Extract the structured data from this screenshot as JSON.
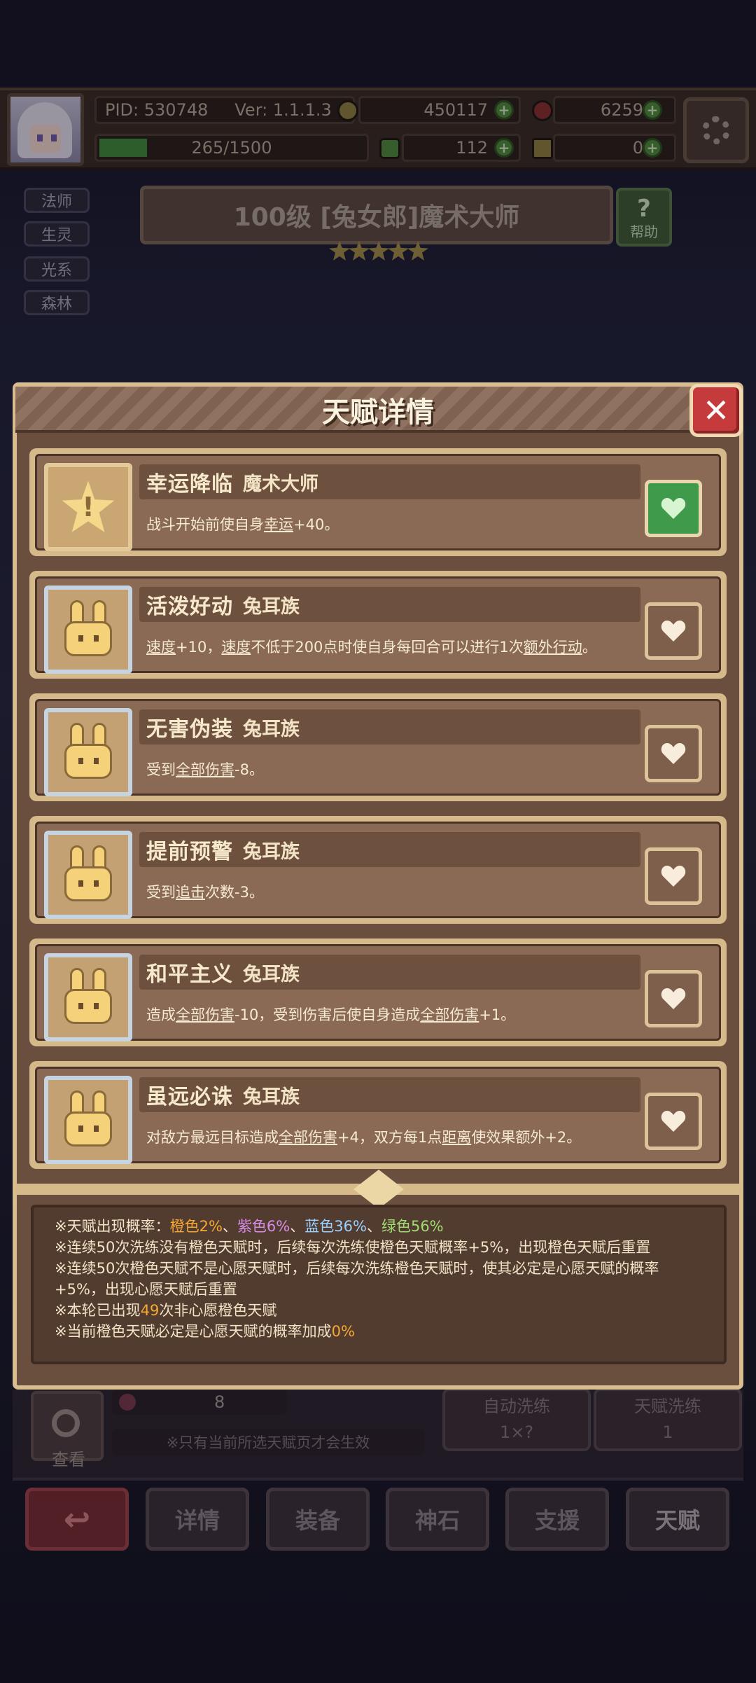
{
  "topbar": {
    "pid": "PID: 530748",
    "ver": "Ver: 1.1.1.3",
    "gold": "450117",
    "gem": "6259",
    "exp": "265/1500",
    "clover": "112",
    "hammer": "0"
  },
  "tags": [
    "法师",
    "生灵",
    "光系",
    "森林"
  ],
  "hero": {
    "title": "100级 [兔女郎]魔术大师",
    "help_label": "帮助",
    "help_symbol": "?"
  },
  "modal": {
    "title": "天赋详情",
    "close_symbol": "✕"
  },
  "talents": [
    {
      "name": "幸运降临",
      "source": "魔术大师",
      "icon": "star-icon",
      "wish": true,
      "desc": [
        {
          "t": "战斗开始前使自身"
        },
        {
          "t": "幸运",
          "u": true
        },
        {
          "t": "+40。"
        }
      ]
    },
    {
      "name": "活泼好动",
      "source": "兔耳族",
      "icon": "bunny-icon",
      "wish": false,
      "desc": [
        {
          "t": "速度",
          "u": true
        },
        {
          "t": "+10，"
        },
        {
          "t": "速度",
          "u": true
        },
        {
          "t": "不低于200点时使自身每回合可以进行1次"
        },
        {
          "t": "额外行动",
          "u": true
        },
        {
          "t": "。"
        }
      ]
    },
    {
      "name": "无害伪装",
      "source": "兔耳族",
      "icon": "bunny-icon",
      "wish": false,
      "desc": [
        {
          "t": "受到"
        },
        {
          "t": "全部伤害",
          "u": true
        },
        {
          "t": "-8。"
        }
      ]
    },
    {
      "name": "提前预警",
      "source": "兔耳族",
      "icon": "bunny-icon",
      "wish": false,
      "desc": [
        {
          "t": "受到"
        },
        {
          "t": "追击",
          "u": true
        },
        {
          "t": "次数-3。"
        }
      ]
    },
    {
      "name": "和平主义",
      "source": "兔耳族",
      "icon": "bunny-icon",
      "wish": false,
      "desc": [
        {
          "t": "造成"
        },
        {
          "t": "全部伤害",
          "u": true
        },
        {
          "t": "-10，受到伤害后使自身造成"
        },
        {
          "t": "全部伤害",
          "u": true
        },
        {
          "t": "+1。"
        }
      ]
    },
    {
      "name": "虽远必诛",
      "source": "兔耳族",
      "icon": "bunny-icon",
      "wish": false,
      "desc": [
        {
          "t": "对敌方最远目标造成"
        },
        {
          "t": "全部伤害",
          "u": true
        },
        {
          "t": "+4，双方每1点"
        },
        {
          "t": "距离",
          "u": true
        },
        {
          "t": "使效果额外+2。"
        }
      ]
    }
  ],
  "info": {
    "line1_prefix": "※天赋出现概率：",
    "orange": "橙色2%",
    "sep1": "、",
    "purple": "紫色6%",
    "sep2": "、",
    "blue": "蓝色36%",
    "sep3": "、",
    "green": "绿色56%",
    "line2": "※连续50次洗练没有橙色天赋时，后续每次洗练使橙色天赋概率+5%，出现橙色天赋后重置",
    "line3a": "※连续50次橙色天赋不是心愿天赋时，后续每次洗练橙色天赋时，使其必定是心愿天赋的概率",
    "line3b": "+5%，出现心愿天赋后重置",
    "line4_pre": "※本轮已出现",
    "line4_num": "49",
    "line4_post": "次非心愿橙色天赋",
    "line5_pre": "※当前橙色天赋必定是心愿天赋的概率加成",
    "line5_num": "0%"
  },
  "under": {
    "search_label": "查看",
    "potion_count": "8",
    "tip": "※只有当前所选天赋页才会生效",
    "auto_wash_label": "自动洗练",
    "auto_wash_value": "1×?",
    "talent_wash_label": "天赋洗练",
    "talent_wash_value": "1"
  },
  "nav": {
    "back_symbol": "↩",
    "items": [
      "详情",
      "装备",
      "神石",
      "支援",
      "天赋"
    ]
  },
  "colors": {
    "orange": "#f5a833",
    "purple": "#d78de6",
    "blue": "#9ad1ff",
    "green": "#9fdc71",
    "frame": "#d8bd90"
  }
}
